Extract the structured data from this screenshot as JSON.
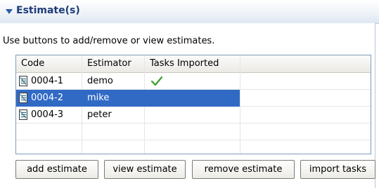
{
  "section": {
    "title": "Estimate(s)"
  },
  "hint": "Use buttons to add/remove or view estimates.",
  "table": {
    "columns": [
      "Code",
      "Estimator",
      "Tasks Imported"
    ],
    "rows": [
      {
        "code": "0004-1",
        "estimator": "demo",
        "tasks_imported": true,
        "selected": false
      },
      {
        "code": "0004-2",
        "estimator": "mike",
        "tasks_imported": false,
        "selected": true
      },
      {
        "code": "0004-3",
        "estimator": "peter",
        "tasks_imported": false,
        "selected": false
      }
    ]
  },
  "buttons": {
    "add": "add estimate",
    "view": "view estimate",
    "remove": "remove estimate",
    "import": "import tasks"
  },
  "colors": {
    "selection": "#316ac5",
    "check": "#3a9b2e",
    "title": "#1e3c78"
  }
}
